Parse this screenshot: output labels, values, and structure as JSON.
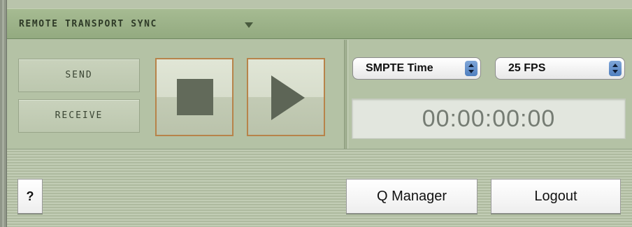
{
  "header": {
    "title": "REMOTE TRANSPORT SYNC",
    "caret_icon": "triangle-down-icon"
  },
  "controls": {
    "send_label": "SEND",
    "receive_label": "RECEIVE",
    "stop_icon": "stop-icon",
    "play_icon": "play-icon"
  },
  "timecode": {
    "timebase_selected": "SMPTE Time",
    "fps_selected": "25 FPS",
    "display": "00:00:00:00"
  },
  "footer": {
    "help_label": "?",
    "q_manager_label": "Q Manager",
    "logout_label": "Logout"
  },
  "colors": {
    "panel_green": "#b4c2a5",
    "header_green": "#9db38a",
    "transport_border": "#b7834a",
    "select_arrow_blue": "#5a88c6"
  }
}
